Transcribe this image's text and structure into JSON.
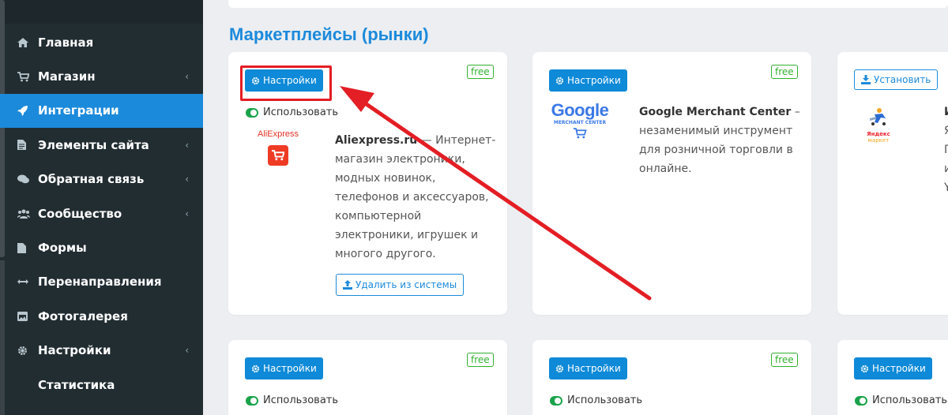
{
  "sidebar": {
    "items": [
      {
        "label": "Главная",
        "icon": "home-icon",
        "chevron": ""
      },
      {
        "label": "Магазин",
        "icon": "cart-icon",
        "chevron": "‹"
      },
      {
        "label": "Интеграции",
        "icon": "rocket-icon",
        "chevron": ""
      },
      {
        "label": "Элементы сайта",
        "icon": "file-icon",
        "chevron": "‹"
      },
      {
        "label": "Обратная связь",
        "icon": "comments-icon",
        "chevron": "‹"
      },
      {
        "label": "Сообщество",
        "icon": "users-icon",
        "chevron": "‹"
      },
      {
        "label": "Формы",
        "icon": "form-icon",
        "chevron": ""
      },
      {
        "label": "Перенаправления",
        "icon": "arrows-icon",
        "chevron": ""
      },
      {
        "label": "Фотогалерея",
        "icon": "image-icon",
        "chevron": ""
      },
      {
        "label": "Настройки",
        "icon": "gear-icon",
        "chevron": "‹"
      },
      {
        "label": "Статистика",
        "icon": "",
        "chevron": ""
      }
    ],
    "active_index": 2
  },
  "main": {
    "section_title": "Маркетплейсы (рынки)",
    "cards": [
      {
        "badge": "free",
        "button": "Настройки",
        "use_label": "Использовать",
        "logo_text": "AliExpress",
        "title": "Aliexpress.ru",
        "desc": " — Интернет-магазин электроники, модных новинок, телефонов и аксессуаров, компьютерной электроники, игрушек и многого другого.",
        "remove_button": "Удалить из системы"
      },
      {
        "badge": "free",
        "button": "Настройки",
        "logo_text": "Google",
        "logo_sub": "MERCHANT CENTER",
        "title": "Google Merchant Center",
        "desc": " – незаменимый инструмент для розничной торговли в онлайне."
      },
      {
        "button": "Установить",
        "logo_text": "Яндекс",
        "logo_sub": "маркет",
        "title": "И",
        "desc_lines": [
          "Я",
          "Г",
          "и",
          "Y"
        ]
      },
      {
        "badge": "free",
        "button": "Настройки",
        "use_label": "Использовать"
      },
      {
        "badge": "free",
        "button": "Настройки",
        "use_label": "Использовать"
      },
      {
        "button": "Настройки",
        "use_label": "Использовать"
      }
    ]
  },
  "colors": {
    "accent": "#1c8adb",
    "sidebar_bg": "#222d32",
    "free_green": "#31b131",
    "annotation_red": "#e31e24"
  }
}
